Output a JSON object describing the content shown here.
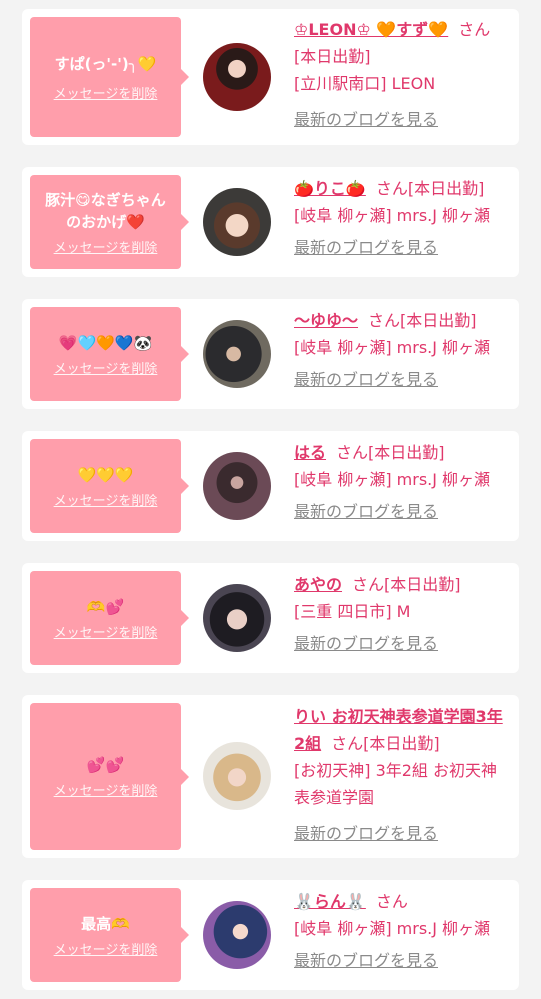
{
  "delete_label": "メッセージを削除",
  "blog_label": "最新のブログを見る",
  "san_label": "さん",
  "entries": [
    {
      "message": "すぱ(っ'-')╮💛",
      "name": "♔LEON♔ 🧡すず🧡",
      "status": "[本日出勤]",
      "shop": "[立川駅南口] LEON"
    },
    {
      "message": "豚汁😋なぎちゃん\nのおかげ❤️",
      "name": "🍅りこ🍅",
      "status": "[本日出勤]",
      "shop": "[岐阜 柳ヶ瀬] mrs.J 柳ヶ瀬"
    },
    {
      "message": "💗🩵🧡💙🐼",
      "name": "〜ゆゆ〜",
      "status": "[本日出勤]",
      "shop": "[岐阜 柳ヶ瀬] mrs.J 柳ヶ瀬"
    },
    {
      "message": "💛💛💛",
      "name": "はる",
      "status": "[本日出勤]",
      "shop": "[岐阜 柳ヶ瀬] mrs.J 柳ヶ瀬"
    },
    {
      "message": "🫶💕",
      "name": "あやの",
      "status": "[本日出勤]",
      "shop": "[三重 四日市] M"
    },
    {
      "message": "💕💕",
      "name": "りい お初天神表参道学園3年2組",
      "status": "[本日出勤]",
      "shop": "[お初天神] 3年2組 お初天神表参道学園"
    },
    {
      "message": "最高🫶",
      "name": "🐰らん🐰",
      "status": "",
      "shop": "[岐阜 柳ヶ瀬] mrs.J 柳ヶ瀬"
    }
  ],
  "colors": {
    "accent": "#e0386b",
    "bubble": "#ff9eab",
    "background": "#f3f3f3",
    "card": "#ffffff",
    "link_gray": "#8a8a8a"
  }
}
